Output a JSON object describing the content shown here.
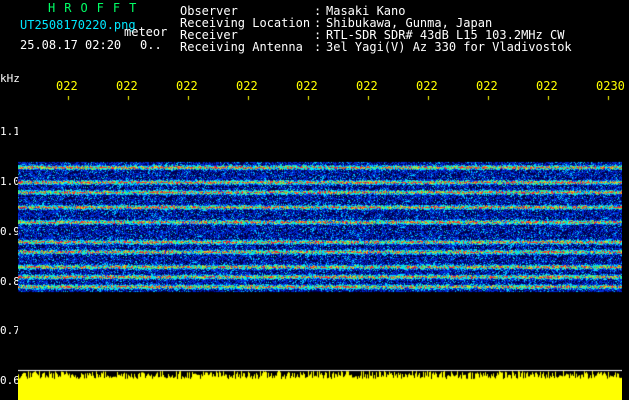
{
  "header": {
    "brand": "HROFFT",
    "filename": "UT2508170220.png",
    "subtitle": "meteor",
    "timestamp": "25.08.17 02:20",
    "counter": "0..",
    "fields": [
      {
        "label": "Observer",
        "value": "Masaki Kano"
      },
      {
        "label": "Receiving Location",
        "value": "Shibukawa, Gunma, Japan"
      },
      {
        "label": "Receiver",
        "value": "RTL-SDR SDR# 43dB L15 103.2MHz CW"
      },
      {
        "label": "Receiving Antenna",
        "value": "3el Yagi(V) Az 330 for Vladivostok"
      }
    ],
    "separator": ":"
  },
  "colors": {
    "background": "#000000",
    "header_label": "#ffffff",
    "brand": "#00ff66",
    "filename": "#00e8ff",
    "axis_x": "#ffff00",
    "axis_y": "#ffffff",
    "noise_floor": "#ffff00"
  },
  "chart_data": {
    "type": "heatmap",
    "ylabel": "kHz",
    "y_ticks": [
      "1.1",
      "1.0",
      "0.9",
      "0.8",
      "0.7",
      "0.6"
    ],
    "x_ticks": [
      "022",
      "022",
      "022",
      "022",
      "022",
      "022",
      "022",
      "022",
      "022",
      "0230"
    ],
    "ylim": [
      0.6,
      1.15
    ],
    "bands_khz": [
      1.03,
      1.0,
      0.98,
      0.95,
      0.92,
      0.88,
      0.86,
      0.83,
      0.81,
      0.79
    ],
    "band_region_khz": [
      0.78,
      1.04
    ]
  }
}
